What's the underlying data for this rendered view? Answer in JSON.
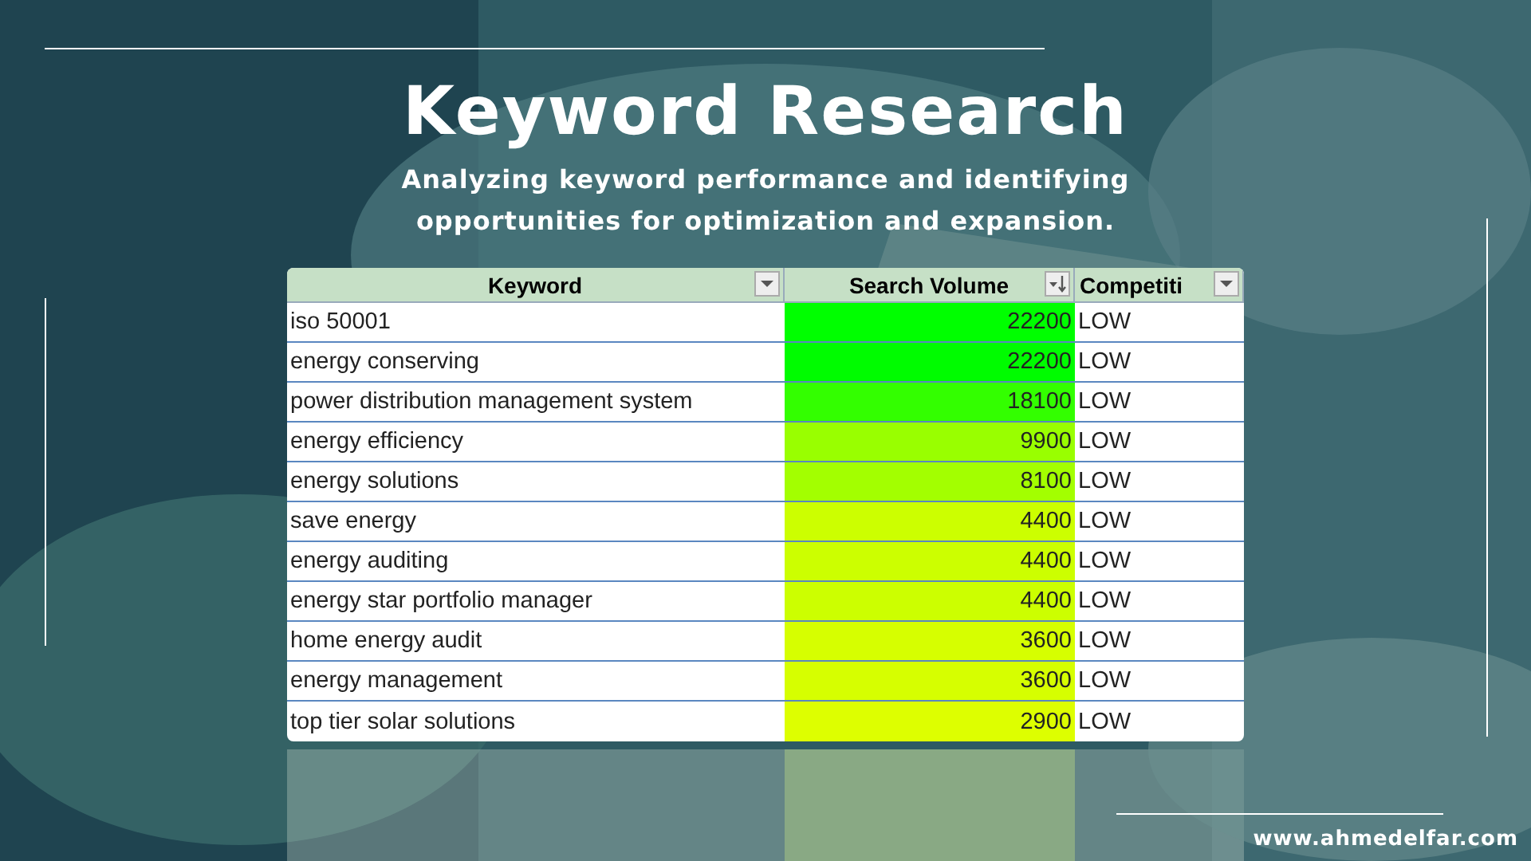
{
  "slide": {
    "title": "Keyword Research",
    "subtitle": "Analyzing keyword performance and identifying opportunities for optimization and expansion.",
    "footer": "www.ahmedelfar.com"
  },
  "table": {
    "columns": [
      {
        "label": "Keyword",
        "kind": "filter"
      },
      {
        "label": "Search Volume",
        "kind": "sort"
      },
      {
        "label": "Competiti",
        "kind": "filter"
      }
    ],
    "rows": [
      {
        "keyword": "iso 50001",
        "volume": "22200",
        "competition": "LOW",
        "color": "#00ff00"
      },
      {
        "keyword": "energy conserving",
        "volume": "22200",
        "competition": "LOW",
        "color": "#00fc00"
      },
      {
        "keyword": "power distribution management system",
        "volume": "18100",
        "competition": "LOW",
        "color": "#33ff00"
      },
      {
        "keyword": "energy efficiency",
        "volume": "9900",
        "competition": "LOW",
        "color": "#99ff00"
      },
      {
        "keyword": "energy solutions",
        "volume": "8100",
        "competition": "LOW",
        "color": "#a3ff00"
      },
      {
        "keyword": "save energy",
        "volume": "4400",
        "competition": "LOW",
        "color": "#ccff00"
      },
      {
        "keyword": "energy auditing",
        "volume": "4400",
        "competition": "LOW",
        "color": "#ccff00"
      },
      {
        "keyword": "energy star portfolio manager",
        "volume": "4400",
        "competition": "LOW",
        "color": "#ccff00"
      },
      {
        "keyword": "home energy audit",
        "volume": "3600",
        "competition": "LOW",
        "color": "#d6ff00"
      },
      {
        "keyword": "energy management",
        "volume": "3600",
        "competition": "LOW",
        "color": "#d6ff00"
      },
      {
        "keyword": "top tier solar solutions",
        "volume": "2900",
        "competition": "LOW",
        "color": "#ddff00"
      }
    ]
  }
}
